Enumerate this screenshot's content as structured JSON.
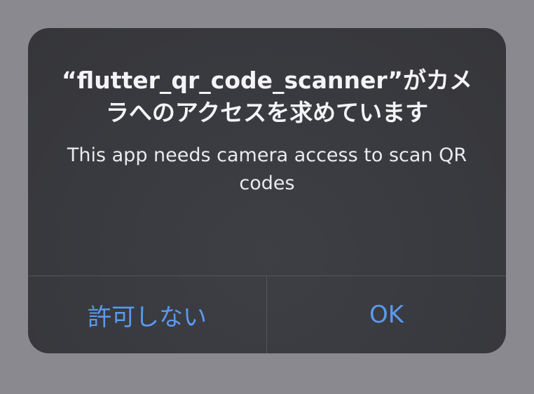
{
  "alert": {
    "title": "“flutter_qr_code_scanner”がカメラへのアクセスを求めています",
    "message": "This app needs camera access to scan QR codes",
    "buttons": {
      "deny_label": "許可しない",
      "ok_label": "OK"
    }
  },
  "colors": {
    "backdrop": "#8a898f",
    "alert_background": "#3a3b40",
    "title_text": "#f4f4f6",
    "message_text": "#eaeaee",
    "button_text": "#5a9af0",
    "separator": "#55565b"
  }
}
